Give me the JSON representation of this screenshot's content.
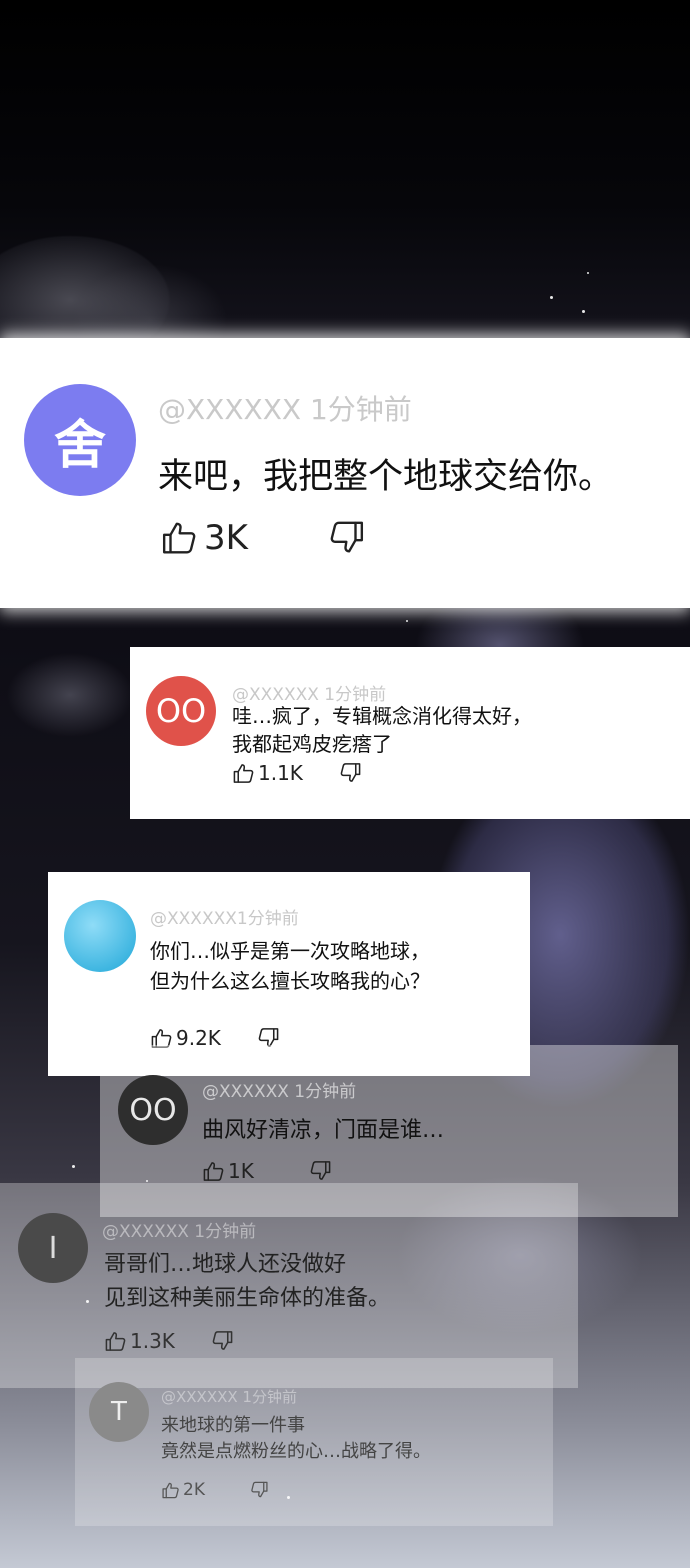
{
  "featured": {
    "avatar_char": "舍",
    "avatar_color": "#7c7cf0",
    "user": "@XXXXXX 1分钟前",
    "text": "来吧，我把整个地球交给你。",
    "likes": "3K"
  },
  "comments": [
    {
      "avatar_char": "OO",
      "avatar_color": "#e0524a",
      "user": "@XXXXXX 1分钟前",
      "line1": "哇…疯了，专辑概念消化得太好，",
      "line2": "我都起鸡皮疙瘩了",
      "likes": "1.1K"
    },
    {
      "avatar_char": "",
      "avatar_color": "#3fb4e2",
      "user": "@XXXXXX1分钟前",
      "line1": "你们…似乎是第一次攻略地球，",
      "line2": "但为什么这么擅长攻略我的心？",
      "likes": "9.2K"
    },
    {
      "avatar_char": "OO",
      "avatar_color": "#333333",
      "user": "@XXXXXX 1分钟前",
      "line1": "曲风好清凉，门面是谁…",
      "likes": "1K"
    },
    {
      "avatar_char": "I",
      "avatar_color": "#555555",
      "user": "@XXXXXX 1分钟前",
      "line1": "哥哥们…地球人还没做好",
      "line2": "见到这种美丽生命体的准备。",
      "likes": "1.3K"
    },
    {
      "avatar_char": "T",
      "avatar_color": "#888888",
      "user": "@XXXXXX 1分钟前",
      "line1": "来地球的第一件事",
      "line2": "竟然是点燃粉丝的心…战略了得。",
      "likes": "2K"
    }
  ]
}
